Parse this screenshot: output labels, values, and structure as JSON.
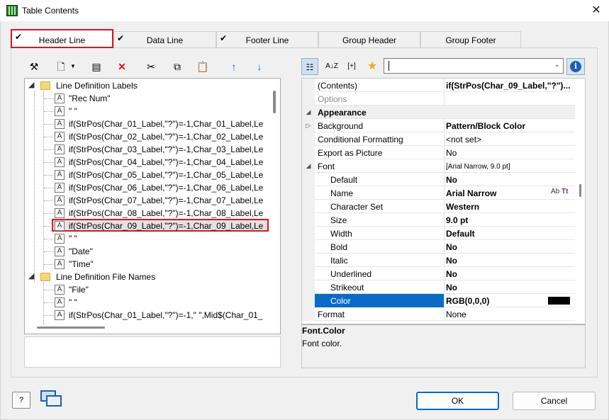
{
  "window": {
    "title": "Table Contents",
    "close_glyph": "✕"
  },
  "tabs": [
    {
      "label": "Header Line",
      "checked": true
    },
    {
      "label": "Data Line",
      "checked": true
    },
    {
      "label": "Footer Line",
      "checked": true
    },
    {
      "label": "Group Header",
      "checked": false
    },
    {
      "label": "Group Footer",
      "checked": false
    }
  ],
  "left_toolbar": {
    "icons": [
      "magic-wand-icon",
      "new-item-icon",
      "dropdown-arrow-icon",
      "properties-icon",
      "delete-icon",
      "cut-icon",
      "copy-icon",
      "paste-icon",
      "move-up-icon",
      "move-down-icon"
    ]
  },
  "tree": {
    "group1": {
      "label": "Line Definition Labels"
    },
    "items1": [
      "\"Rec Num\"",
      "\" \"",
      "if(StrPos(Char_01_Label,\"?\")=-1,Char_01_Label,Le",
      "if(StrPos(Char_02_Label,\"?\")=-1,Char_02_Label,Le",
      "if(StrPos(Char_03_Label,\"?\")=-1,Char_03_Label,Le",
      "if(StrPos(Char_04_Label,\"?\")=-1,Char_04_Label,Le",
      "if(StrPos(Char_05_Label,\"?\")=-1,Char_05_Label,Le",
      "if(StrPos(Char_06_Label,\"?\")=-1,Char_06_Label,Le",
      "if(StrPos(Char_07_Label,\"?\")=-1,Char_07_Label,Le",
      "if(StrPos(Char_08_Label,\"?\")=-1,Char_08_Label,Le",
      "if(StrPos(Char_09_Label,\"?\")=-1,Char_09_Label,Le",
      "\" \"",
      "\"Date\"",
      "\"Time\""
    ],
    "group2": {
      "label": "Line Definition File Names"
    },
    "items2": [
      "\"File\"",
      "\" \"",
      "if(StrPos(Char_01_Label,\"?\")=-1,\" \",Mid$(Char_01_"
    ],
    "selected_index": 10
  },
  "right_toolbar": {
    "buttons": [
      "categorized-icon",
      "sort-az-icon",
      "expand-icon",
      "favorite-icon"
    ],
    "expand_label": "[+]",
    "sort_label": "A↓Z",
    "combo_value": "",
    "info_glyph": "i"
  },
  "properties": {
    "contents": {
      "name": "(Contents)",
      "value": "if(StrPos(Char_09_Label,\"?\")..."
    },
    "options": {
      "name": "Options",
      "value": ""
    },
    "appearance": {
      "name": "Appearance"
    },
    "background": {
      "name": "Background",
      "value": "Pattern/Block Color"
    },
    "conditional": {
      "name": "Conditional Formatting",
      "value": "<not set>"
    },
    "export_picture": {
      "name": "Export as Picture",
      "value": "No"
    },
    "font": {
      "name": "Font",
      "value": "[Arial Narrow, 9.0 pt]"
    },
    "default": {
      "name": "Default",
      "value": "No"
    },
    "fname": {
      "name": "Name",
      "value": "Arial Narrow"
    },
    "charset": {
      "name": "Character Set",
      "value": "Western"
    },
    "size": {
      "name": "Size",
      "value": "9.0 pt"
    },
    "width": {
      "name": "Width",
      "value": "Default"
    },
    "bold": {
      "name": "Bold",
      "value": "No"
    },
    "italic": {
      "name": "Italic",
      "value": "No"
    },
    "underlined": {
      "name": "Underlined",
      "value": "No"
    },
    "strikeout": {
      "name": "Strikeout",
      "value": "No"
    },
    "color": {
      "name": "Color",
      "value": "RGB(0,0,0)",
      "swatch": "#000000"
    },
    "format": {
      "name": "Format",
      "value": "None"
    },
    "font_picker": {
      "ab": "Ab",
      "tt": "Tt"
    }
  },
  "description": {
    "title": "Font.Color",
    "text": "Font color."
  },
  "buttons": {
    "help_label": "?",
    "ok": "OK",
    "cancel": "Cancel"
  },
  "colors": {
    "accent": "#0a6ac6",
    "highlight_border": "#d9161d"
  }
}
